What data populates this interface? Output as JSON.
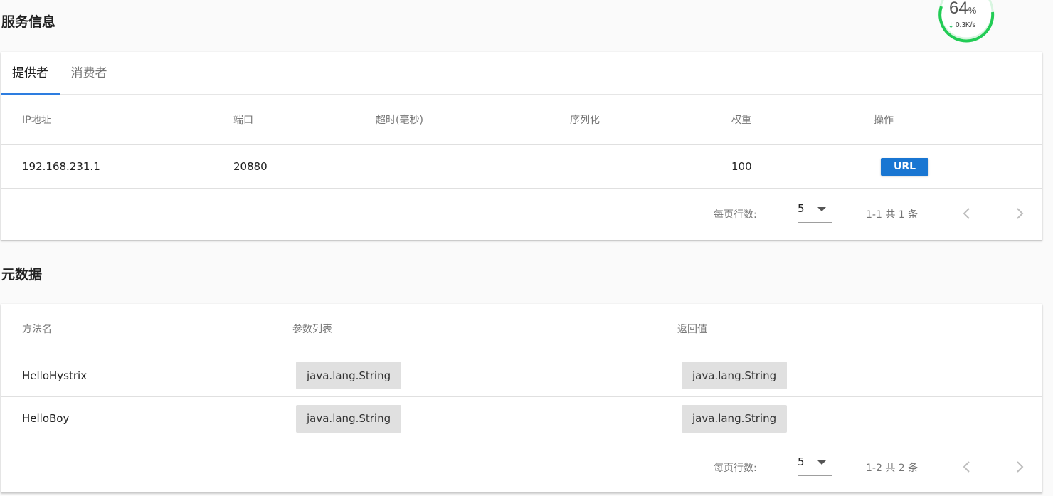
{
  "service": {
    "title": "服务信息",
    "tabs": [
      {
        "label": "提供者"
      },
      {
        "label": "消费者"
      }
    ],
    "columns": [
      "IP地址",
      "端口",
      "超时(毫秒)",
      "序列化",
      "权重",
      "操作"
    ],
    "rows": [
      {
        "ip": "192.168.231.1",
        "port": "20880",
        "timeout": "",
        "serialization": "",
        "weight": "100",
        "action": "URL"
      }
    ],
    "pagination": {
      "rows_per_page_label": "每页行数:",
      "rows_per_page": "5",
      "range": "1-1 共 1 条"
    }
  },
  "metadata": {
    "title": "元数据",
    "columns": [
      "方法名",
      "参数列表",
      "返回值"
    ],
    "rows": [
      {
        "method": "HelloHystrix",
        "params": "java.lang.String",
        "return": "java.lang.String"
      },
      {
        "method": "HelloBoy",
        "params": "java.lang.String",
        "return": "java.lang.String"
      }
    ],
    "pagination": {
      "rows_per_page_label": "每页行数:",
      "rows_per_page": "5",
      "range": "1-2 共 2 条"
    }
  },
  "speed_widget": {
    "percent": "64",
    "percent_unit": "%",
    "rate": "0.3K/s",
    "ring_color": "#22cc55"
  },
  "colors": {
    "accent": "#1976d2",
    "tab_indicator": "#2d7de0"
  }
}
